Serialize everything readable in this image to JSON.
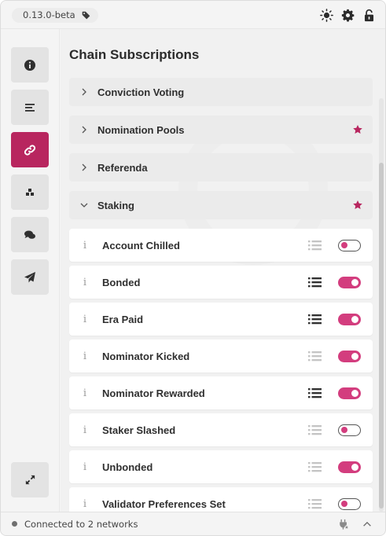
{
  "header": {
    "version": "0.13.0-beta",
    "icons": [
      "tag-icon",
      "sun-icon",
      "gear-icon",
      "unlock-icon"
    ]
  },
  "sidebar": {
    "items": [
      {
        "icon": "info-circle-icon",
        "active": false
      },
      {
        "icon": "list-icon",
        "active": false
      },
      {
        "icon": "link-icon",
        "active": true
      },
      {
        "icon": "cubes-icon",
        "active": false
      },
      {
        "icon": "comments-icon",
        "active": false
      },
      {
        "icon": "paper-plane-icon",
        "active": false
      }
    ],
    "bottom_icon": "expand-icon"
  },
  "main": {
    "title": "Chain Subscriptions",
    "categories": [
      {
        "label": "Conviction Voting",
        "expanded": false,
        "starred": false
      },
      {
        "label": "Nomination Pools",
        "expanded": false,
        "starred": true
      },
      {
        "label": "Referenda",
        "expanded": false,
        "starred": false
      },
      {
        "label": "Staking",
        "expanded": true,
        "starred": true
      }
    ],
    "subscriptions": [
      {
        "info": "i",
        "label": "Account Chilled",
        "list_active": false,
        "enabled": false
      },
      {
        "info": "i",
        "label": "Bonded",
        "list_active": true,
        "enabled": true
      },
      {
        "info": "i",
        "label": "Era Paid",
        "list_active": true,
        "enabled": true
      },
      {
        "info": "i",
        "label": "Nominator Kicked",
        "list_active": false,
        "enabled": true
      },
      {
        "info": "i",
        "label": "Nominator Rewarded",
        "list_active": true,
        "enabled": true
      },
      {
        "info": "i",
        "label": "Staker Slashed",
        "list_active": false,
        "enabled": false
      },
      {
        "info": "i",
        "label": "Unbonded",
        "list_active": false,
        "enabled": true
      },
      {
        "info": "i",
        "label": "Validator Preferences Set",
        "list_active": false,
        "enabled": false
      }
    ]
  },
  "status": {
    "text": "Connected to 2 networks",
    "icons": [
      "plug-icon",
      "chevron-up-icon"
    ]
  },
  "colors": {
    "accent": "#b8265f",
    "toggle_on": "#d33d7e",
    "star": "#b8265f"
  }
}
